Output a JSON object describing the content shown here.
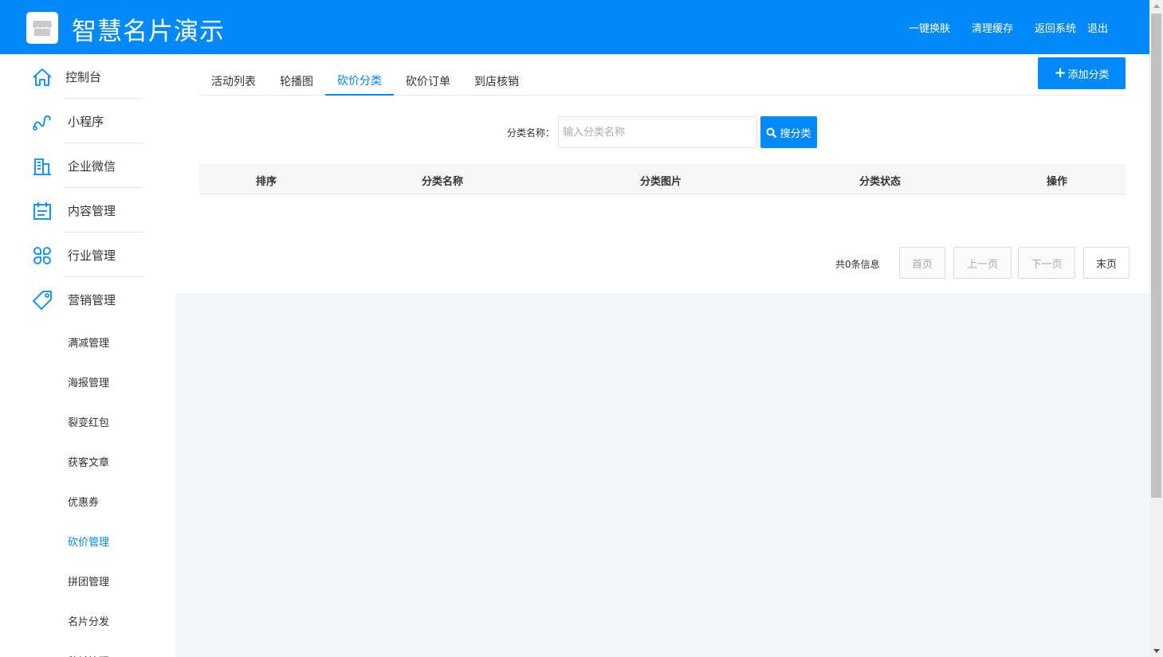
{
  "header": {
    "title": "智慧名片演示",
    "links": [
      "一键换肤",
      "清理缓存",
      "返回系统",
      "退出"
    ],
    "bg_color": "#0089f7"
  },
  "sidebar": {
    "main_items": [
      {
        "label": "控制台",
        "icon": "home-icon"
      },
      {
        "label": "小程序",
        "icon": "link-icon"
      },
      {
        "label": "企业微信",
        "icon": "building-icon"
      },
      {
        "label": "内容管理",
        "icon": "calendar-icon"
      },
      {
        "label": "行业管理",
        "icon": "grid-icon"
      },
      {
        "label": "营销管理",
        "icon": "tag-icon"
      }
    ],
    "sub_items": [
      "满减管理",
      "海报管理",
      "裂变红包",
      "获客文章",
      "优惠券",
      "砍价管理",
      "拼团管理",
      "名片分发",
      "秒杀管理"
    ],
    "active_sub": "砍价管理"
  },
  "tabs": [
    "活动列表",
    "轮播图",
    "砍价分类",
    "砍价订单",
    "到店核销"
  ],
  "active_tab": "砍价分类",
  "add_button": "添加分类",
  "search": {
    "label": "分类名称：",
    "placeholder": "输入分类名称",
    "button": "搜分类"
  },
  "table": {
    "columns": [
      "排序",
      "分类名称",
      "分类图片",
      "分类状态",
      "操作"
    ],
    "rows": []
  },
  "pager": {
    "info": "共0条信息",
    "first": "首页",
    "prev": "上一页",
    "next": "下一页",
    "last": "末页"
  },
  "accent_color": "#0089f7"
}
